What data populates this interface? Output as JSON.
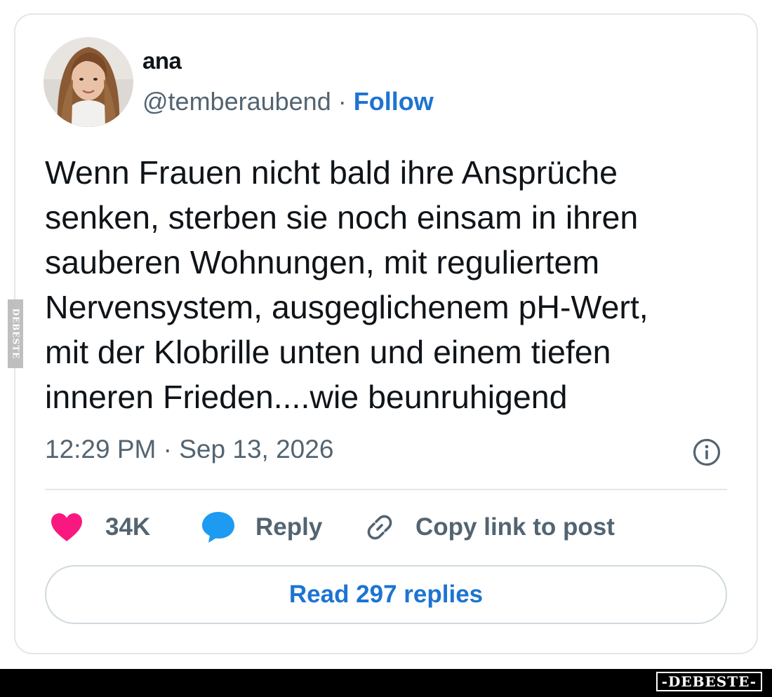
{
  "tweet": {
    "author": {
      "display_name": "ana",
      "handle": "@temberaubend",
      "separator": " · ",
      "follow_label": "Follow",
      "avatar_icon": "user-avatar-photo"
    },
    "text_lines": [
      "Wenn Frauen nicht bald ihre Ansprüche",
      "senken, sterben sie noch einsam in ihren",
      "sauberen Wohnungen, mit reguliertem",
      "Nervensystem, ausgeglichenem pH-Wert,",
      "mit der Klobrille unten und einem tiefen",
      "inneren Frieden....wie beunruhigend"
    ],
    "timestamp": "12:29 PM · Sep 13, 2026",
    "info_icon": "info-circle-icon",
    "actions": {
      "like_count": "34K",
      "like_icon": "heart-icon",
      "reply_label": "Reply",
      "reply_icon": "speech-bubble-icon",
      "copy_label": "Copy link to post",
      "copy_icon": "link-icon"
    },
    "read_replies_label": "Read 297 replies"
  },
  "watermark": {
    "side_text": "DEBESTE",
    "footer_text": "-DEBESTE-"
  },
  "colors": {
    "accent_blue": "#1d74d2",
    "heart_pink": "#f91880",
    "reply_blue": "#1d9bf0",
    "text_primary": "#0f1419",
    "text_secondary": "#536471",
    "border": "#e3e6ea"
  }
}
